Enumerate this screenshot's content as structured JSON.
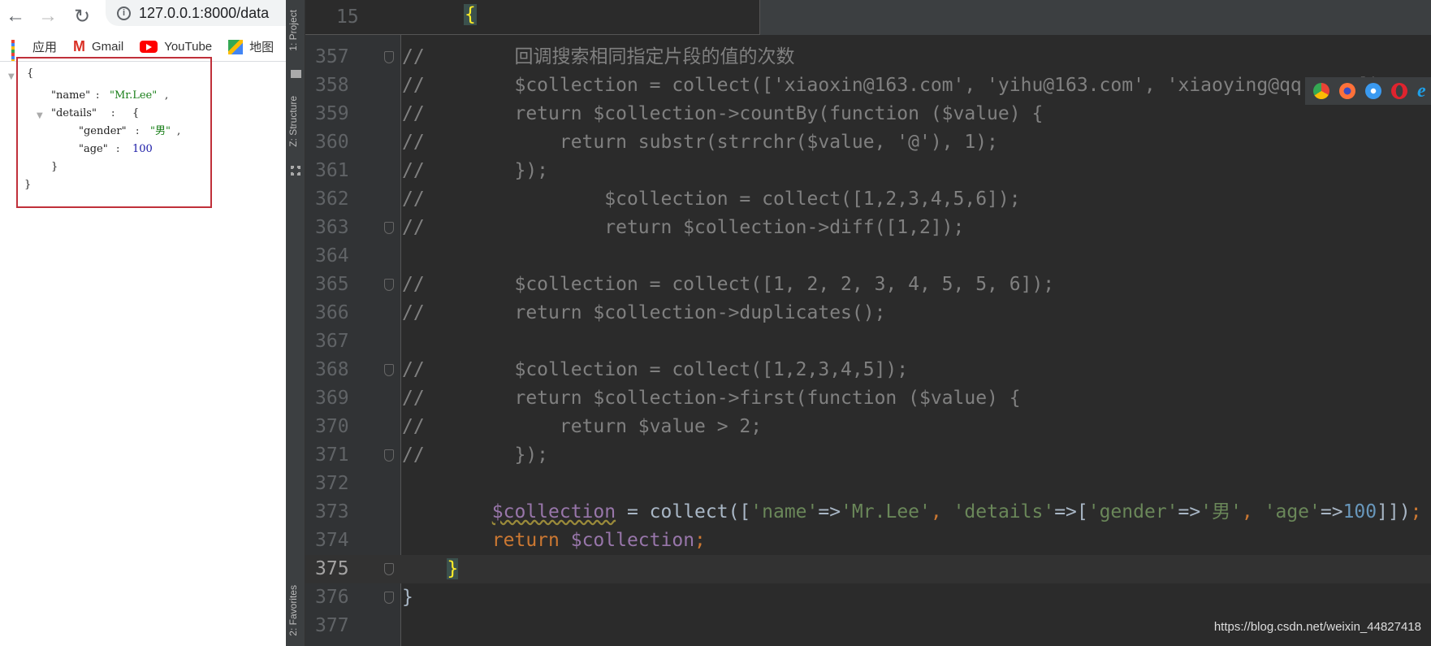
{
  "browser": {
    "url": "127.0.0.1:8000/data",
    "nav": {
      "back": "←",
      "forward": "→",
      "reload": "↻"
    },
    "bookmarks": [
      {
        "label": "应用",
        "icon": "apps-grid-icon"
      },
      {
        "label": "Gmail",
        "icon": "gmail-icon"
      },
      {
        "label": "YouTube",
        "icon": "youtube-icon"
      },
      {
        "label": "地图",
        "icon": "maps-icon"
      }
    ],
    "json_view": {
      "open": "{",
      "close": "}",
      "name_key": "\"name\"",
      "name_value": "\"Mr.Lee\"",
      "details_key": "\"details\"",
      "gender_key": "\"gender\"",
      "gender_value": "\"男\"",
      "age_key": "\"age\"",
      "age_value": "100"
    }
  },
  "ide": {
    "side_tabs": {
      "project": "1: Project",
      "structure": "Z: Structure",
      "favorites": "2: Favorites"
    },
    "sticky_line": {
      "number": "15",
      "text": "{"
    },
    "lines": [
      {
        "n": "357",
        "fold": true,
        "seg": [
          [
            "c",
            "//        回调搜索相同指定片段的值的次数"
          ]
        ]
      },
      {
        "n": "358",
        "seg": [
          [
            "c",
            "//        $collection = collect(['xiaoxin@163.com', 'yihu@163.com', 'xiaoying@qq.com']);"
          ]
        ]
      },
      {
        "n": "359",
        "seg": [
          [
            "c",
            "//        return $collection->countBy(function ($value) {"
          ]
        ]
      },
      {
        "n": "360",
        "seg": [
          [
            "c",
            "//            return substr(strrchr($value, '@'), 1);"
          ]
        ]
      },
      {
        "n": "361",
        "seg": [
          [
            "c",
            "//        });"
          ]
        ]
      },
      {
        "n": "362",
        "seg": [
          [
            "c",
            "//                $collection = collect([1,2,3,4,5,6]);"
          ]
        ]
      },
      {
        "n": "363",
        "fold": true,
        "seg": [
          [
            "c",
            "//                return $collection->diff([1,2]);"
          ]
        ]
      },
      {
        "n": "364",
        "seg": []
      },
      {
        "n": "365",
        "fold": true,
        "seg": [
          [
            "c",
            "//        $collection = collect([1, 2, 2, 3, 4, 5, 5, 6]);"
          ]
        ]
      },
      {
        "n": "366",
        "seg": [
          [
            "c",
            "//        return $collection->duplicates();"
          ]
        ]
      },
      {
        "n": "367",
        "seg": []
      },
      {
        "n": "368",
        "fold": true,
        "seg": [
          [
            "c",
            "//        $collection = collect([1,2,3,4,5]);"
          ]
        ]
      },
      {
        "n": "369",
        "seg": [
          [
            "c",
            "//        return $collection->first(function ($value) {"
          ]
        ]
      },
      {
        "n": "370",
        "seg": [
          [
            "c",
            "//            return $value > 2;"
          ]
        ]
      },
      {
        "n": "371",
        "fold": true,
        "seg": [
          [
            "c",
            "//        });"
          ]
        ]
      },
      {
        "n": "372",
        "seg": []
      },
      {
        "n": "373",
        "seg": [
          [
            "d",
            "        "
          ],
          [
            "v wavy",
            "$collection"
          ],
          [
            "d",
            " = collect(["
          ],
          [
            "s",
            "'name'"
          ],
          [
            "d",
            "=>"
          ],
          [
            "s",
            "'Mr.Lee'"
          ],
          [
            "k",
            ", "
          ],
          [
            "s",
            "'details'"
          ],
          [
            "d",
            "=>["
          ],
          [
            "s",
            "'gender'"
          ],
          [
            "d",
            "=>"
          ],
          [
            "s",
            "'男'"
          ],
          [
            "k",
            ", "
          ],
          [
            "s",
            "'age'"
          ],
          [
            "d",
            "=>"
          ],
          [
            "n",
            "100"
          ],
          [
            "d",
            "]])"
          ],
          [
            "k",
            ";"
          ]
        ]
      },
      {
        "n": "374",
        "seg": [
          [
            "k",
            "        return "
          ],
          [
            "v",
            "$collection"
          ],
          [
            "k",
            ";"
          ]
        ]
      },
      {
        "n": "375",
        "fold": true,
        "current": true,
        "seg": [
          [
            "d",
            "    "
          ],
          [
            "b",
            "}"
          ]
        ]
      },
      {
        "n": "376",
        "fold": true,
        "seg": [
          [
            "d",
            "}"
          ]
        ]
      },
      {
        "n": "377",
        "seg": []
      }
    ],
    "browser_popup": [
      "chrome-icon",
      "firefox-icon",
      "safari-icon",
      "opera-icon",
      "ie-icon"
    ]
  },
  "watermark": "https://blog.csdn.net/weixin_44827418"
}
